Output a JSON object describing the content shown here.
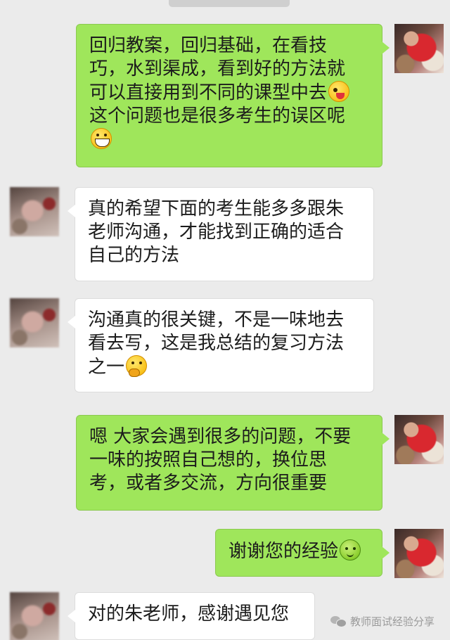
{
  "status": {
    "time_pill": ""
  },
  "messages": [
    {
      "side": "out",
      "lines": [
        "回归教案，回归基础，在看技",
        "巧，水到渠成，看到好的方法就",
        "可以直接用到不同的课型中去",
        "这个问题也是很多考生的误区呢",
        ""
      ],
      "emojis": [
        "wink-tongue-emoji",
        "grin-emoji"
      ]
    },
    {
      "side": "in",
      "lines": [
        "真的希望下面的考生能多多跟朱",
        "老师沟通，才能找到正确的适合",
        "自己的方法"
      ]
    },
    {
      "side": "in",
      "lines": [
        "沟通真的很关键，不是一味地去",
        "看去写，这是我总结的复习方法",
        "之一"
      ],
      "emojis": [
        "thinking-emoji"
      ]
    },
    {
      "side": "out",
      "lines": [
        "嗯 大家会遇到很多的问题，不要",
        "一味的按照自己想的，换位思",
        "考，或者多交流，方向很重要"
      ]
    },
    {
      "side": "out",
      "lines": [
        "谢谢您的经验"
      ],
      "emojis": [
        "leaf-smile-emoji"
      ]
    },
    {
      "side": "in",
      "lines": [
        "对的朱老师，感谢遇见您"
      ]
    }
  ],
  "watermark": {
    "text": "教师面试经验分享"
  },
  "colors": {
    "background": "#ebebeb",
    "outgoing_bubble": "#9fe65b",
    "incoming_bubble": "#ffffff"
  }
}
